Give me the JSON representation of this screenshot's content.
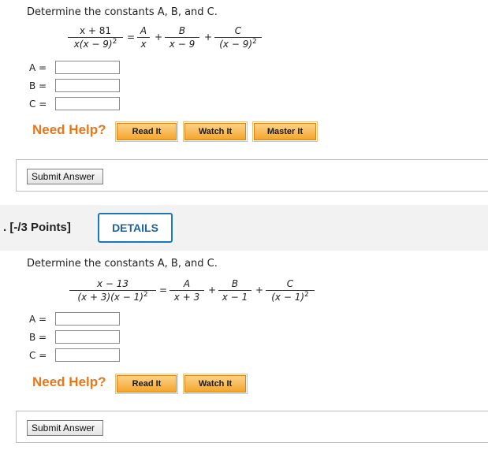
{
  "q1": {
    "prompt": "Determine the constants A, B, and C.",
    "lhs": {
      "num": "x + 81",
      "den_base": "x(x − 9)",
      "den_exp": "2"
    },
    "eq": "=",
    "t1": {
      "num": "A",
      "den": "x"
    },
    "plus1": "+",
    "t2": {
      "num": "B",
      "den": "x − 9"
    },
    "plus2": "+",
    "t3": {
      "num": "C",
      "den_base": "(x − 9)",
      "den_exp": "2"
    },
    "inputs": [
      {
        "label": "A =",
        "value": ""
      },
      {
        "label": "B =",
        "value": ""
      },
      {
        "label": "C =",
        "value": ""
      }
    ],
    "need_help": "Need Help?",
    "help_buttons": [
      "Read It",
      "Watch It",
      "Master It"
    ],
    "submit": "Submit Answer"
  },
  "q2_header": {
    "points": ". [-/3 Points]",
    "details": "DETAILS"
  },
  "q2": {
    "prompt": "Determine the constants A, B, and C.",
    "lhs": {
      "num": "x − 13",
      "den_base": "(x + 3)(x − 1)",
      "den_exp": "2"
    },
    "eq": "=",
    "t1": {
      "num": "A",
      "den": "x + 3"
    },
    "plus1": "+",
    "t2": {
      "num": "B",
      "den": "x − 1"
    },
    "plus2": "+",
    "t3": {
      "num": "C",
      "den_base": "(x − 1)",
      "den_exp": "2"
    },
    "inputs": [
      {
        "label": "A =",
        "value": ""
      },
      {
        "label": "B =",
        "value": ""
      },
      {
        "label": "C =",
        "value": ""
      }
    ],
    "need_help": "Need Help?",
    "help_buttons": [
      "Read It",
      "Watch It"
    ],
    "submit": "Submit Answer"
  },
  "colors": {
    "help_orange": "#e8771a",
    "details_blue": "#1c78b4",
    "divider_gray": "#f2f2f2"
  }
}
